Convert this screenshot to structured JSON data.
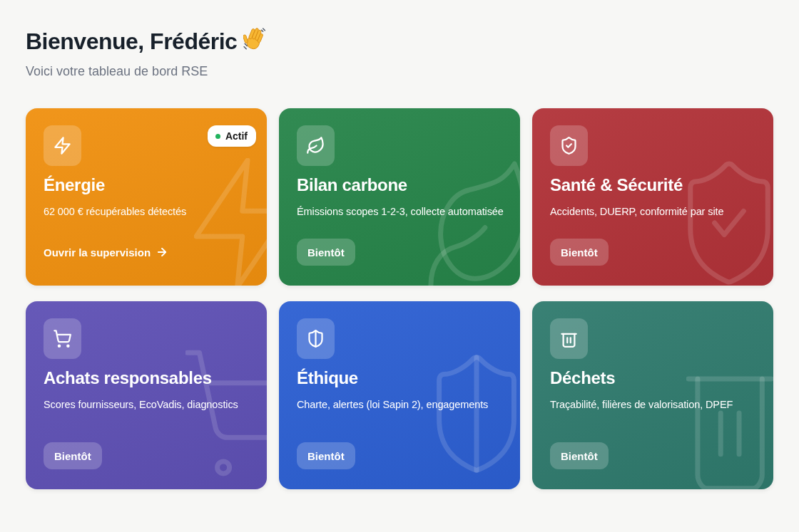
{
  "header": {
    "title": "Bienvenue, Frédéric",
    "subtitle": "Voici votre tableau de bord RSE"
  },
  "modules": [
    {
      "kind": "active",
      "title": "Énergie",
      "description": "62 000 € récupérables détectés",
      "color": "#f0900f",
      "badge": "Actif",
      "action": "Ouvrir la supervision"
    },
    {
      "kind": "soon",
      "title": "Bilan carbone",
      "description": "Émissions scopes 1-2-3, collecte automatisée",
      "color": "#268449",
      "action": "Bientôt"
    },
    {
      "kind": "soon",
      "title": "Santé & Sécurité",
      "description": "Accidents, DUERP, conformité par site",
      "color": "#b13238",
      "action": "Bientôt"
    },
    {
      "kind": "soon",
      "title": "Achats responsables",
      "description": "Scores fournisseurs, EcoVadis, diagnostics",
      "color": "#5e50b4",
      "action": "Bientôt"
    },
    {
      "kind": "soon",
      "title": "Éthique",
      "description": "Charte, alertes (loi Sapin 2), engagements",
      "color": "#2c5fd2",
      "action": "Bientôt"
    },
    {
      "kind": "soon",
      "title": "Déchets",
      "description": "Traçabilité, filières de valorisation, DPEF",
      "color": "#2f7a6d",
      "action": "Bientôt"
    }
  ]
}
